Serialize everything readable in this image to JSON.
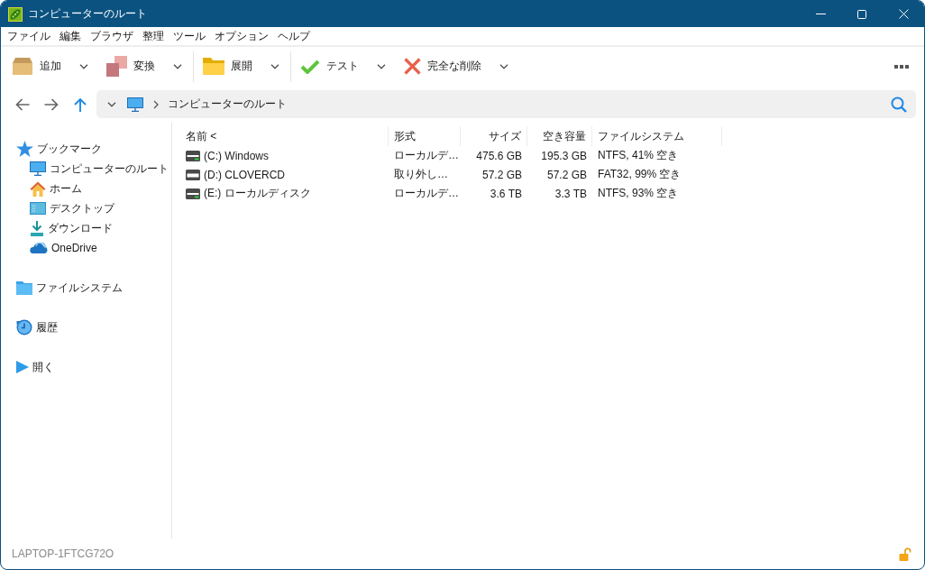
{
  "window": {
    "title": "コンピューターのルート"
  },
  "menu": [
    {
      "label": "ファイル"
    },
    {
      "label": "編集"
    },
    {
      "label": "ブラウザ"
    },
    {
      "label": "整理"
    },
    {
      "label": "ツール"
    },
    {
      "label": "オプション"
    },
    {
      "label": "ヘルプ"
    }
  ],
  "toolbar": {
    "groups": [
      {
        "buttons": [
          {
            "label": "追加",
            "dropdown": true
          },
          {
            "label": "変換",
            "dropdown": true
          }
        ]
      },
      {
        "buttons": [
          {
            "label": "展開",
            "dropdown": true
          }
        ]
      },
      {
        "buttons": [
          {
            "label": "テスト",
            "dropdown": true
          },
          {
            "label": "完全な削除",
            "dropdown": true
          }
        ]
      }
    ]
  },
  "address_bar": {
    "path": [
      {
        "label": "コンピューターのルート"
      }
    ]
  },
  "sidebar": {
    "sections": [
      {
        "label": "ブックマーク",
        "children": [
          {
            "label": "コンピューターのルート"
          },
          {
            "label": "ホーム"
          },
          {
            "label": "デスクトップ"
          },
          {
            "label": "ダウンロード"
          },
          {
            "label": "OneDrive"
          }
        ]
      },
      {
        "label": "ファイルシステム"
      },
      {
        "label": "履歴"
      },
      {
        "label": "開く"
      }
    ]
  },
  "table": {
    "columns": [
      {
        "label": "名前 <"
      },
      {
        "label": "形式"
      },
      {
        "label": "サイズ"
      },
      {
        "label": "空き容量"
      },
      {
        "label": "ファイルシステム"
      }
    ],
    "rows": [
      {
        "kind": "fixed",
        "name": "(C:) Windows",
        "type": "ローカルデ…",
        "size": "475.6 GB",
        "free": "195.3 GB",
        "file_system": "NTFS, 41% 空き"
      },
      {
        "kind": "removable",
        "name": "(D:) CLOVERCD",
        "type": "取り外し…",
        "size": "57.2 GB",
        "free": "57.2 GB",
        "file_system": "FAT32, 99% 空き"
      },
      {
        "kind": "fixed",
        "name": "(E:) ローカルディスク",
        "type": "ローカルデ…",
        "size": "3.6 TB",
        "free": "3.3 TB",
        "file_system": "NTFS, 93% 空き"
      }
    ]
  },
  "status_bar": {
    "computer_name": "LAPTOP-1FTCG72O",
    "locked": false
  }
}
